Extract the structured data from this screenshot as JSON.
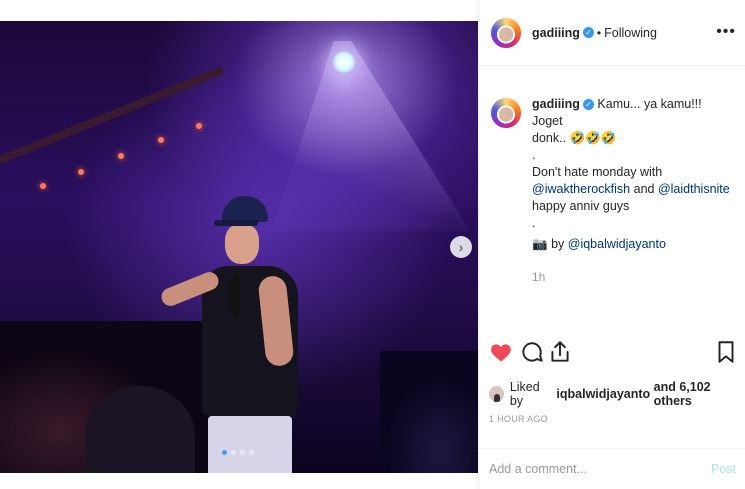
{
  "post": {
    "username": "gadiiing",
    "verified": true,
    "separator": "•",
    "follow_state": "Following",
    "more_label": "•••",
    "caption_lines": [
      "Kamu... ya kamu!!! Joget",
      "donk.. 🤣🤣🤣",
      ".",
      "Don't hate monday with",
      "happy anniv guys",
      ".",
      "by"
    ],
    "caption_mentions": {
      "first": "@iwaktherockfish",
      "and": "and",
      "second": "@laidthisnite",
      "photographer": "@iqbalwidjayanto",
      "camera_emoji": "📷"
    },
    "relative_time": "1h",
    "likes": {
      "prefix": "Liked by",
      "user": "iqbalwidjayanto",
      "suffix": "and 6,102 others"
    },
    "timestamp": "1 HOUR AGO",
    "comment_placeholder": "Add a comment...",
    "post_button": "Post"
  },
  "carousel": {
    "next_icon": "›",
    "active_index": 0,
    "count": 4
  },
  "colors": {
    "heart": "#ed4956",
    "link": "#003569",
    "verified": "#3897f0",
    "carousel_active": "#3d9df6",
    "post_button": "#b2dffc"
  },
  "icons": [
    "heart-icon",
    "comment-icon",
    "share-icon",
    "bookmark-icon",
    "chevron-right-icon",
    "verified-icon",
    "more-icon"
  ]
}
